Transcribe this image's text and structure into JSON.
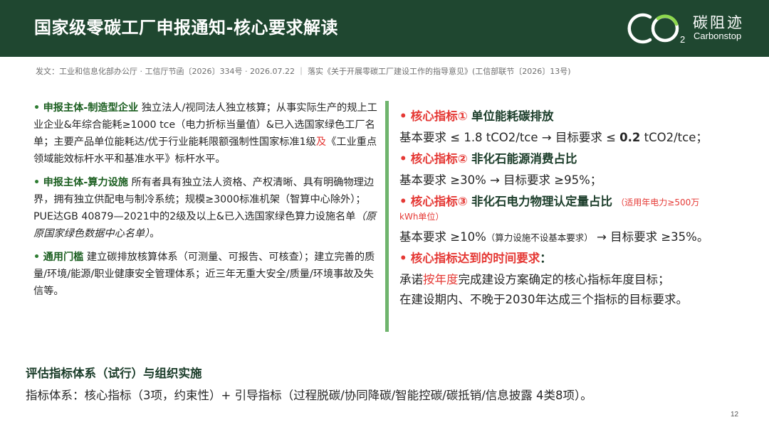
{
  "header": {
    "title": "国家级零碳工厂申报通知-核心要求解读",
    "logo": {
      "zh": "碳阻迹",
      "en": "Carbonstop",
      "mark": "CO2"
    }
  },
  "meta": "发文：工业和信息化部办公厅 · 工信厅节函〔2026〕334号 · 2026.07.22 ｜ 落实《关于开展零碳工厂建设工作的指导意见》(工信部联节〔2026〕13号)",
  "left": {
    "bullet": "•",
    "p1": {
      "head": "申报主体-制造型企业",
      "text1": "独立法人/视同法人独立核算；从事实际生产的规上工业企业&年综合能耗≥1000 tce（电力折标当量值）&已入选国家绿色工厂名单；主要产品单位能耗达/优于行业能耗限额强制性国家标准1级",
      "red": "及",
      "text2": "《工业重点领域能效标杆水平和基准水平》标杆水平。"
    },
    "p2": {
      "head": "申报主体-算力设施",
      "text1": "所有者具有独立法人资格、产权清晰、具有明确物理边界，拥有独立供配电与制冷系统；规模≥3000标准机架（智算中心除外）；PUE达GB 40879—2021中的2级及以上&已入选国家绿色算力设施名单",
      "italic": "（原原国家绿色数据中心名单）",
      "text2": "。"
    },
    "p3": {
      "head": "通用门槛",
      "text": "建立碳排放核算体系（可测量、可报告、可核查）；建立完善的质量/环境/能源/职业健康安全管理体系；近三年无重大安全/质量/环境事故及失信等。"
    }
  },
  "right": {
    "bullet": "•",
    "k1": {
      "label": "核心指标①",
      "title": "单位能耗碳排放",
      "req_a": "基本要求 ≤ 1.8 tCO2/tce → 目标要求 ≤ ",
      "req_bold": "0.2",
      "req_b": " tCO2/tce；"
    },
    "k2": {
      "label": "核心指标②",
      "title": "非化石能源消费占比",
      "req": "基本要求 ≥30% → 目标要求 ≥95%；"
    },
    "k3": {
      "label": "核心指标③",
      "title": "非化石电力物理认定量占比",
      "note_a": "（适用年电力≥500万",
      "note_b": "kWh单位）",
      "req_a": "基本要求 ≥10%",
      "req_small": "（算力设施不设基本要求）",
      "req_b": "→ 目标要求 ≥35%。"
    },
    "k4": {
      "label": "核心指标达到的时间要求",
      "colon": "：",
      "line1_a": "承诺",
      "line1_red": "按年度",
      "line1_b": "完成建设方案确定的核心指标年度目标；",
      "line2": "在建设期内、不晚于2030年达成三个指标的目标要求。"
    }
  },
  "evaluation": {
    "title": "评估指标体系（试行）与组织实施",
    "body": "指标体系：核心指标（3项，约束性）+ 引导指标（过程脱碳/协同降碳/智能控碳/碳抵销/信息披露 4类8项）。"
  },
  "page_number": "12",
  "colors": {
    "header_bg": "#1f4730",
    "accent_green": "#6fb46d",
    "accent_red": "#e53935",
    "heading_green": "#1b5e20"
  }
}
